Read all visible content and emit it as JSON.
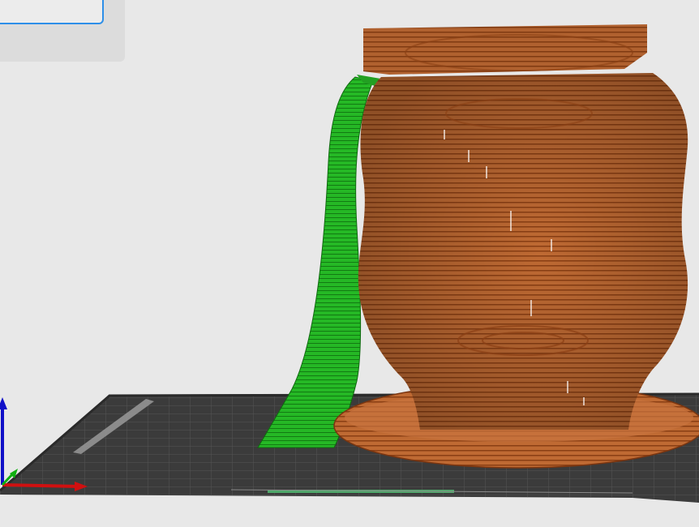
{
  "app": {
    "view": "3D viewport"
  },
  "scene": {
    "objects": [
      {
        "name": "vase",
        "color": "#b8602b"
      },
      {
        "name": "support",
        "color": "#22b022"
      }
    ],
    "bed_color": "#3b3b3b",
    "axis_colors": {
      "x": "#d01010",
      "y": "#10b010",
      "z": "#1010c8"
    }
  },
  "top_panel": {
    "input_value": ""
  }
}
